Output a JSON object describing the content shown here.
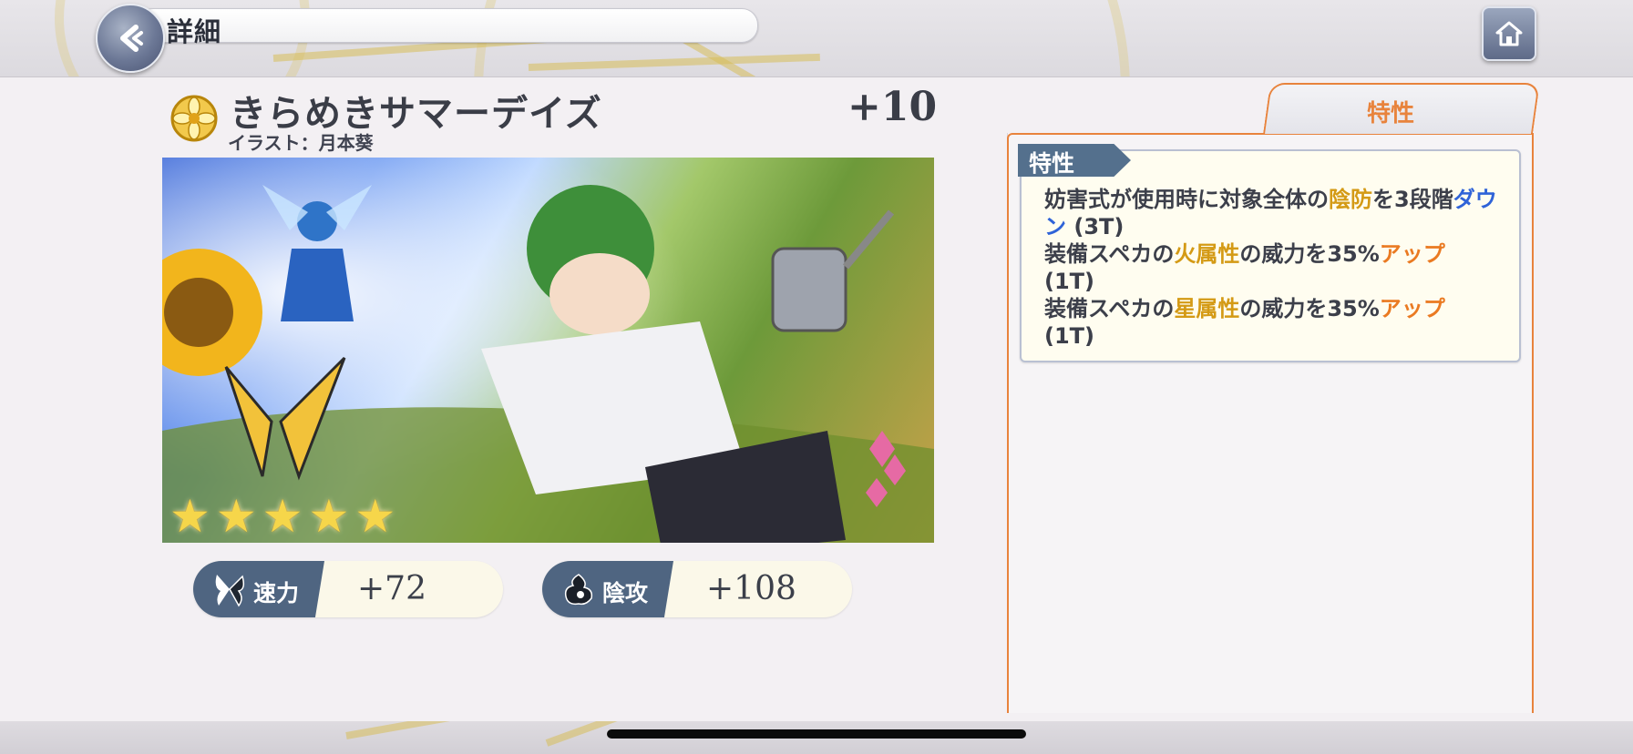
{
  "header": {
    "title": "詳細",
    "back_icon": "back-arrow-icon",
    "home_icon": "home-icon"
  },
  "card": {
    "name": "きらめきサマーデイズ",
    "illustrator": "イラスト：月本葵",
    "plus": "+10",
    "stars": 5
  },
  "stats": [
    {
      "label": "速力",
      "value": "+72",
      "icon": "butterfly-icon"
    },
    {
      "label": "陰攻",
      "value": "+108",
      "icon": "dark-flame-icon"
    }
  ],
  "panel": {
    "tab_label": "特性",
    "trait_label": "特性",
    "lines": [
      {
        "a": "妨害式が使用時に対象全体の",
        "b": "陰防",
        "c": "を3段階",
        "d": "ダウン",
        "e": " (3T)"
      },
      {
        "a": "装備スペカの",
        "b": "火属性",
        "c": "の威力を35%",
        "d": "アップ",
        "e": "(1T)"
      },
      {
        "a": "装備スペカの",
        "b": "星属性",
        "c": "の威力を35%",
        "d": "アップ",
        "e": "(1T)"
      }
    ]
  },
  "colors": {
    "accent": "#e8833c",
    "stat_label_bg": "#4f6581",
    "highlight_yellow": "#d49a15",
    "highlight_orange": "#ea7a22",
    "highlight_blue": "#2f63d8"
  }
}
